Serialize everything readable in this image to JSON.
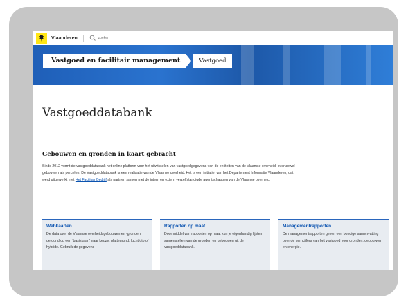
{
  "topbar": {
    "brand": "Vlaanderen",
    "search_placeholder": "zoeker"
  },
  "header": {
    "breadcrumb_main": "Vastgoed en facilitair management",
    "breadcrumb_sub": "Vastgoed"
  },
  "main": {
    "page_title": "Vastgoeddatabank",
    "section_heading": "Gebouwen en gronden in kaart gebracht",
    "intro_before_link": "Sinds 2012 vormt de vastgoeddatabank het online platform voor het uitwisselen van vastgoedgegevens van de entiteiten van de Vlaamse overheid, over zowel gebouwen als percelen. De Vastgoeddatabank is een realisatie van de Vlaamse overheid. Het is een initiatief van het Departement Informatie Vlaanderen, dat werd uitgewerkt met",
    "intro_link": "Het Facilitair Bedrijf",
    "intro_after_link": "als partner, samen met de intern en extern verzelfstandigde agentschappen van de Vlaamse overheid."
  },
  "cards": [
    {
      "title": "Webkaarten",
      "text": "De data over de Vlaamse overheidsgebouwen en -gronden getoond op een 'basiskaart' naar keuze: plattegrond, luchtfoto of hybride. Gebruik de gegevens"
    },
    {
      "title": "Rapporten op maat",
      "text": "Door middel van rapporten op maat kun je eigenhandig lijsten samenstellen van de gronden en gebouwen uit de vastgoeddatabank."
    },
    {
      "title": "Managementrapporten",
      "text": "De managementrapporten geven een bondige samenvatting over de kerncijfers van het vastgoed voor gronden, gebouwen en energie."
    }
  ],
  "colors": {
    "brand_yellow": "#ffe615",
    "link_blue": "#0b53b0",
    "banner_blue": "#2a73cf",
    "card_bg": "#e8ecf1"
  }
}
